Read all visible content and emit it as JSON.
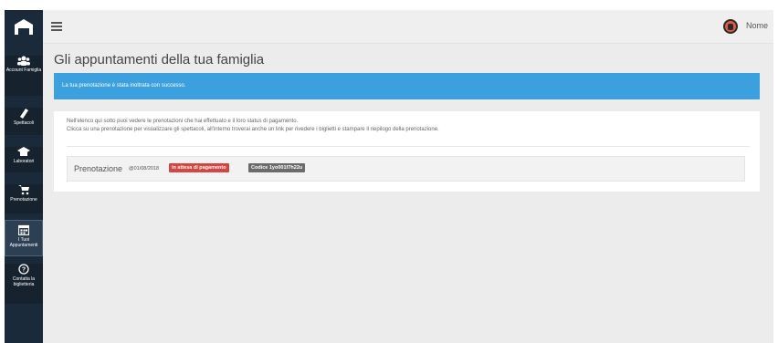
{
  "sidebar": {
    "items": [
      {
        "icon": "users-icon",
        "label": "Account Famiglia"
      },
      {
        "icon": "ticket-icon",
        "label": "Spettacoli"
      },
      {
        "icon": "graduation-cap-icon",
        "label": "Laboratori"
      },
      {
        "icon": "cart-icon",
        "label": "Prenotazione"
      },
      {
        "icon": "calendar-icon",
        "label": "I Tuoi Appuntamenti"
      },
      {
        "icon": "help-circle-icon",
        "label": "Contatta la biglietteria"
      }
    ]
  },
  "topbar": {
    "user_name": "Nome"
  },
  "main": {
    "title": "Gli appuntamenti della tua famiglia",
    "alert": "La tua prenotazione è stata inoltrata con successo.",
    "info_line1": "Nell'elenco qui sotto puoi vedere le prenotazioni che hai effettuato e il loro status di pagamento.",
    "info_line2": "Clicca su una prenotazione per visualizzare gli spettacoli, all'interno troverai anche un link per rivedere i biglietti e stampare il riepilogo della prenotazione.",
    "booking": {
      "label": "Prenotazione",
      "date": "@01/08/2018",
      "status": "in attesa di pagamento",
      "code": "Codice 1yo001f7h22u"
    }
  },
  "colors": {
    "sidebar": "#1b2a3a",
    "alert": "#3ba0dd",
    "status_badge": "#d64541",
    "code_badge": "#6b6b6b",
    "avatar": "#e05a4a"
  }
}
